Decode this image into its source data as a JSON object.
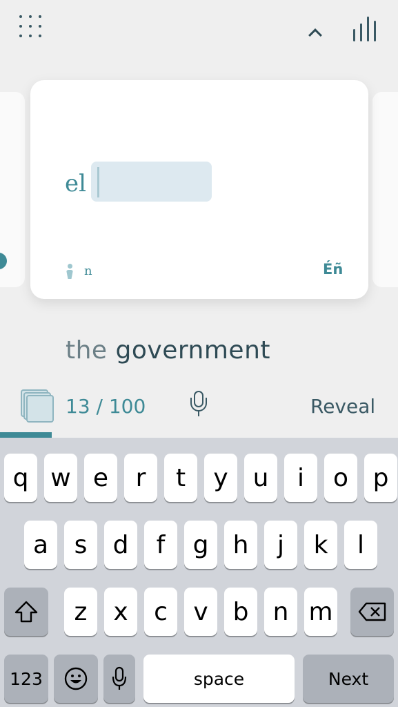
{
  "card": {
    "article": "el",
    "answer_value": "",
    "part_of_speech": "n",
    "language_toggle": "Éñ"
  },
  "translation": {
    "article": "the",
    "word": "government"
  },
  "session": {
    "progress_text": "13 / 100",
    "reveal_label": "Reveal",
    "progress_fraction": 0.13
  },
  "keyboard": {
    "row1": [
      "q",
      "w",
      "e",
      "r",
      "t",
      "y",
      "u",
      "i",
      "o",
      "p"
    ],
    "row2": [
      "a",
      "s",
      "d",
      "f",
      "g",
      "h",
      "j",
      "k",
      "l"
    ],
    "row3": [
      "z",
      "x",
      "c",
      "v",
      "b",
      "n",
      "m"
    ],
    "numbers_label": "123",
    "space_label": "space",
    "next_label": "Next"
  },
  "icons": {
    "menu": "grid-dots-icon",
    "collapse": "chevron-up-icon",
    "stats": "bar-chart-icon",
    "gender": "person-icon",
    "cards": "card-stack-icon",
    "mic": "microphone-icon",
    "shift": "shift-icon",
    "delete": "backspace-icon",
    "emoji": "emoji-icon",
    "dictation": "microphone-icon"
  },
  "colors": {
    "accent": "#3e8a96",
    "dark_text": "#2e4a54",
    "input_bg": "#dde9f0",
    "keyboard_bg": "#d1d4da"
  }
}
